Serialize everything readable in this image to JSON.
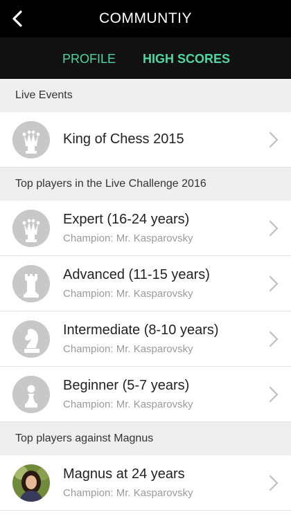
{
  "header": {
    "title": "COMMUNTIY"
  },
  "tabs": [
    {
      "label": "PROFILE"
    },
    {
      "label": "HIGH SCORES",
      "active": true
    }
  ],
  "sections": [
    {
      "title": "Live Events",
      "items": [
        {
          "title": "King of Chess 2015",
          "icon": "crown-icon"
        }
      ]
    },
    {
      "title": "Top players in the Live Challenge 2016",
      "items": [
        {
          "title": "Expert (16-24 years)",
          "subtitle": "Champion: Mr. Kasparovsky",
          "icon": "crown-icon"
        },
        {
          "title": "Advanced (11-15 years)",
          "subtitle": "Champion: Mr. Kasparovsky",
          "icon": "rook-icon"
        },
        {
          "title": "Intermediate (8-10 years)",
          "subtitle": "Champion: Mr. Kasparovsky",
          "icon": "knight-icon"
        },
        {
          "title": "Beginner (5-7 years)",
          "subtitle": "Champion: Mr. Kasparovsky",
          "icon": "pawn-icon"
        }
      ]
    },
    {
      "title": "Top players against Magnus",
      "items": [
        {
          "title": "Magnus at 24 years",
          "subtitle": "Champion: Mr. Kasparovsky",
          "icon": "user-photo"
        }
      ]
    }
  ],
  "colors": {
    "accent": "#4fd7a4",
    "header_bg": "#000000",
    "section_bg": "#efefef"
  }
}
